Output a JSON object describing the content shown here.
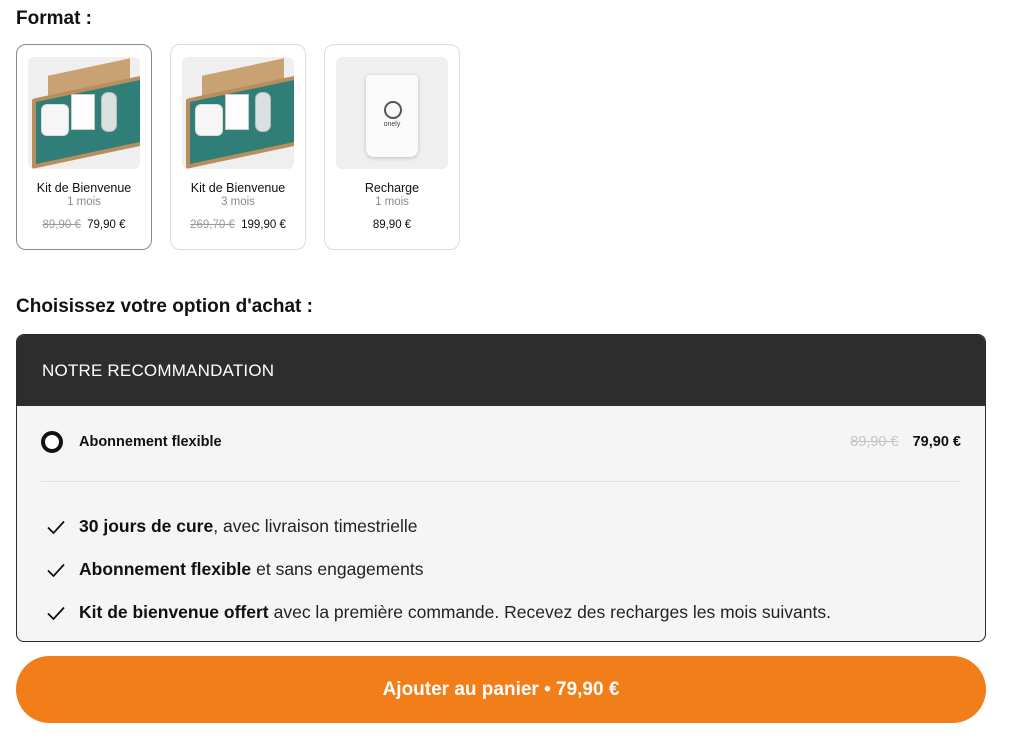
{
  "format": {
    "title": "Format :",
    "cards": [
      {
        "name": "Kit de Bienvenue",
        "duration": "1 mois",
        "old_price": "89,90 €",
        "price": "79,90 €",
        "selected": true
      },
      {
        "name": "Kit de Bienvenue",
        "duration": "3 mois",
        "old_price": "269,70 €",
        "price": "199,90 €",
        "selected": false
      },
      {
        "name": "Recharge",
        "duration": "1 mois",
        "old_price": "",
        "price": "89,90 €",
        "selected": false,
        "brand": "onely"
      }
    ]
  },
  "purchase": {
    "title": "Choisissez votre option d'achat :",
    "header": "NOTRE RECOMMANDATION",
    "option": {
      "label": "Abonnement flexible",
      "old_price": "89,90 €",
      "price": "79,90 €"
    },
    "benefits": [
      {
        "strong": "30 jours de cure",
        "text": ", avec livraison timestrielle"
      },
      {
        "strong": "Abonnement flexible",
        "text": "et sans engagements"
      },
      {
        "strong": "Kit de bienvenue offert",
        "text": "avec la première commande. Recevez des recharges les mois suivants."
      }
    ]
  },
  "cart_button": {
    "label": "Ajouter au panier • 79,90 €"
  },
  "colors": {
    "accent": "#f27e1a",
    "header_bg": "#2d2d2d",
    "box_teal": "#2f7f78"
  },
  "icons": {
    "check": "check-icon",
    "radio": "radio-icon"
  }
}
